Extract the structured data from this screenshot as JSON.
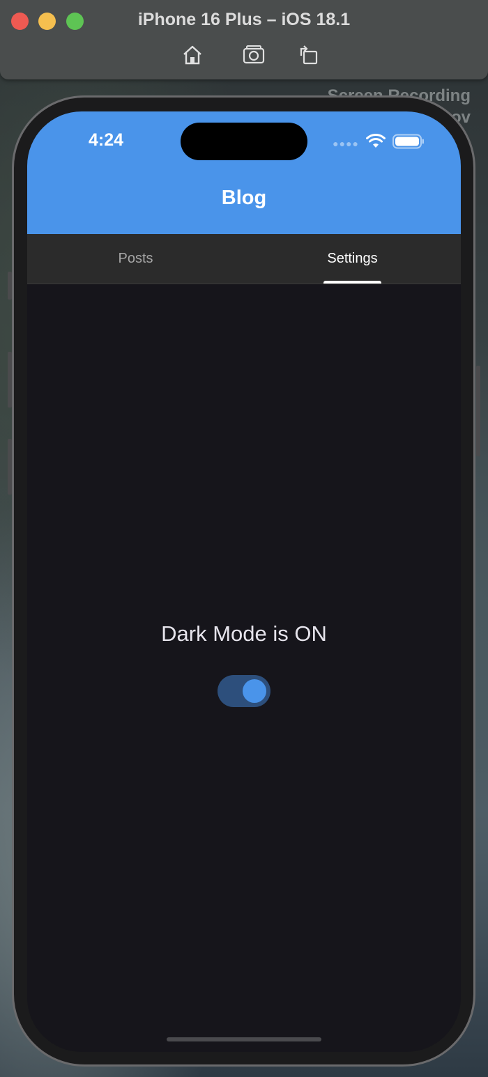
{
  "window": {
    "title": "iPhone 16 Plus – iOS 18.1",
    "toolbar": [
      "home-icon",
      "screenshot-icon",
      "rotate-icon"
    ],
    "overlay_text_line1": "Screen Recording",
    "overlay_text_line2": "ov"
  },
  "status_bar": {
    "time": "4:24",
    "icons": [
      "signal-dots-icon",
      "wifi-icon",
      "battery-icon"
    ]
  },
  "app": {
    "title": "Blog",
    "tabs": [
      {
        "label": "Posts",
        "selected": false
      },
      {
        "label": "Settings",
        "selected": true
      }
    ],
    "settings": {
      "dark_mode_text": "Dark Mode is ON",
      "dark_mode_toggle_on": true
    }
  },
  "colors": {
    "header": "#4a94ea",
    "tabbar": "#2b2b2b",
    "background": "#16151b",
    "toggle_track": "#2d4f7c",
    "toggle_knob": "#4a94ea"
  }
}
